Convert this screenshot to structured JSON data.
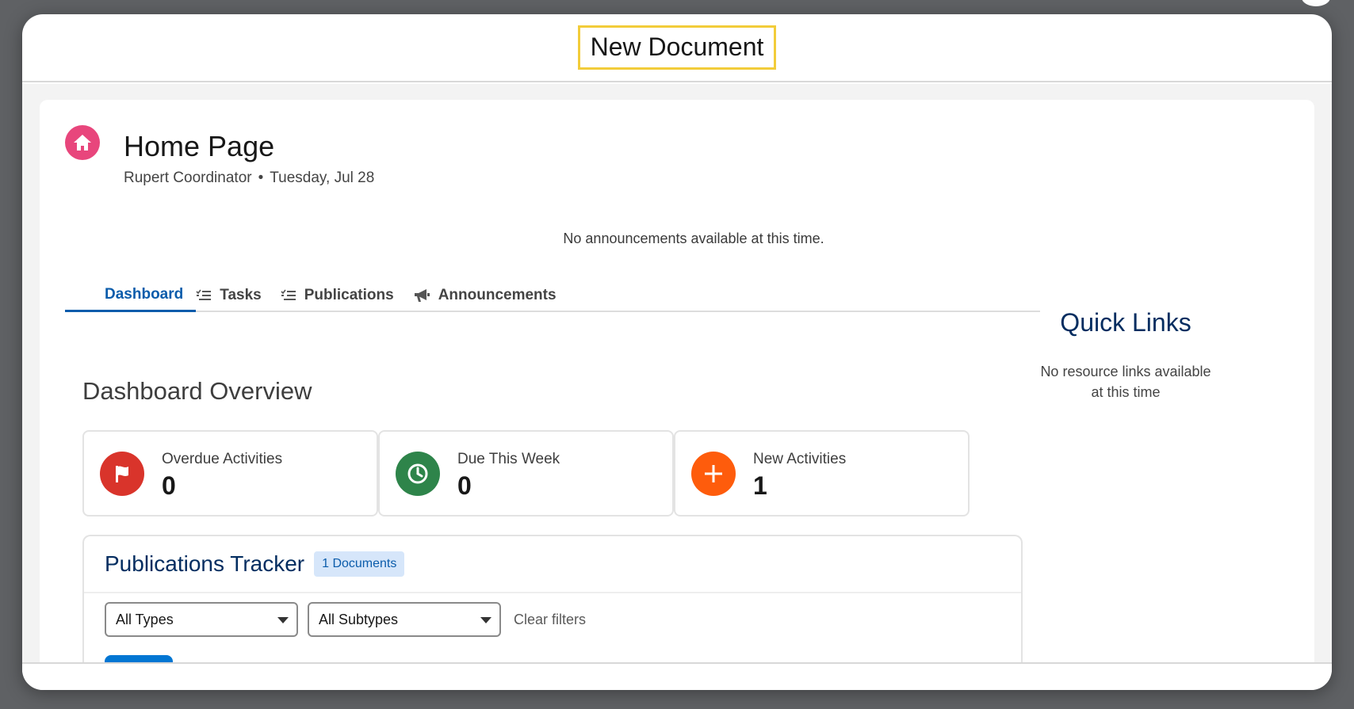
{
  "modal": {
    "title": "New Document"
  },
  "page": {
    "title": "Home Page",
    "user": "Rupert Coordinator",
    "separator": "•",
    "date": "Tuesday, Jul 28",
    "announcements_empty": "No announcements available at this time."
  },
  "tabs": [
    {
      "label": "Dashboard",
      "icon": "none",
      "active": true
    },
    {
      "label": "Tasks",
      "icon": "list-icon",
      "active": false
    },
    {
      "label": "Publications",
      "icon": "list-icon",
      "active": false
    },
    {
      "label": "Announcements",
      "icon": "megaphone-icon",
      "active": false
    }
  ],
  "dashboard": {
    "title": "Dashboard Overview",
    "stats": [
      {
        "label": "Overdue Activities",
        "value": "0",
        "icon": "flag-icon",
        "color": "#d9342b"
      },
      {
        "label": "Due This Week",
        "value": "0",
        "icon": "clock-icon",
        "color": "#2e844a"
      },
      {
        "label": "New Activities",
        "value": "1",
        "icon": "plus-icon",
        "color": "#fe5c0c"
      }
    ]
  },
  "tracker": {
    "title": "Publications Tracker",
    "badge": "1 Documents",
    "filters": {
      "type": "All Types",
      "subtype": "All Subtypes",
      "clear": "Clear filters"
    }
  },
  "quick_links": {
    "title": "Quick Links",
    "empty": "No resource links available at this time"
  },
  "colors": {
    "accent": "#0b5cab",
    "home_icon": "#e8467c",
    "title_highlight": "#f2cc3a",
    "heading_navy": "#032d60"
  }
}
